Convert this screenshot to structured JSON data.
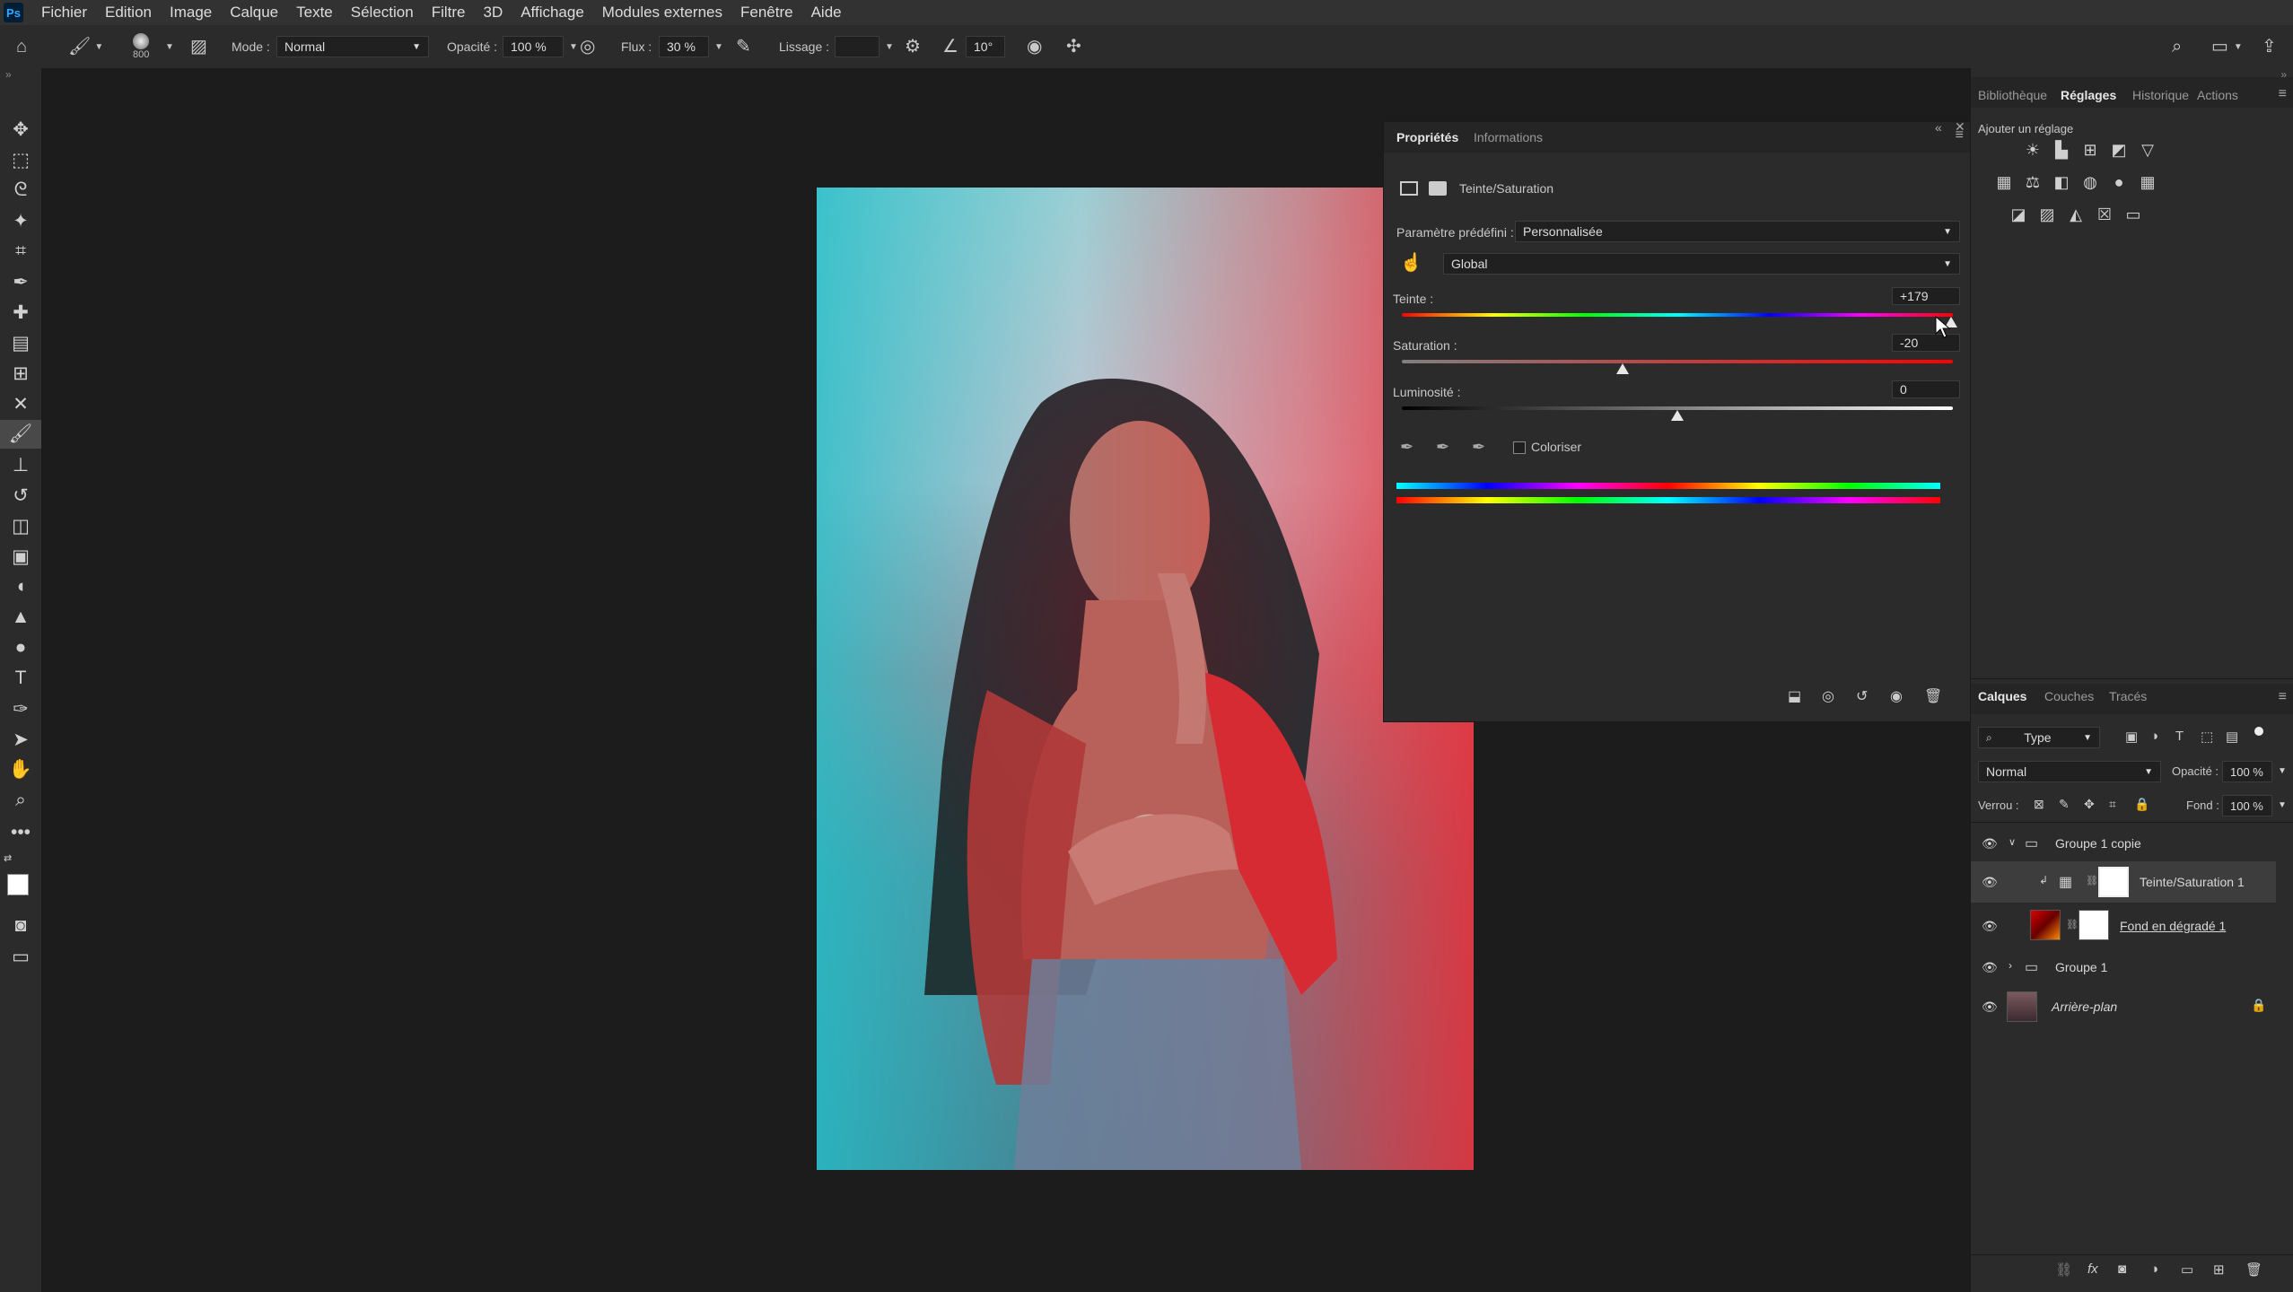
{
  "menu": {
    "app_logo": "Ps",
    "items": [
      "Fichier",
      "Edition",
      "Image",
      "Calque",
      "Texte",
      "Sélection",
      "Filtre",
      "3D",
      "Affichage",
      "Modules externes",
      "Fenêtre",
      "Aide"
    ]
  },
  "options": {
    "brush_size": "800",
    "mode_label": "Mode :",
    "mode_value": "Normal",
    "opacity_label": "Opacité :",
    "opacity_value": "100 %",
    "flow_label": "Flux :",
    "flow_value": "30 %",
    "smoothing_label": "Lissage :",
    "angle_value": "10°"
  },
  "properties": {
    "tabs": [
      "Propriétés",
      "Informations"
    ],
    "adjustment_title": "Teinte/Saturation",
    "preset_label": "Paramètre prédéfini :",
    "preset_value": "Personnalisée",
    "channel_value": "Global",
    "hue_label": "Teinte :",
    "hue_value": "+179",
    "hue_fraction": 0.997,
    "saturation_label": "Saturation :",
    "saturation_value": "-20",
    "saturation_fraction": 0.4,
    "lightness_label": "Luminosité :",
    "lightness_value": "0",
    "lightness_fraction": 0.5,
    "colorize_label": "Coloriser"
  },
  "adjustments_panel": {
    "tabs": [
      "Bibliothèque",
      "Réglages",
      "Historique",
      "Actions"
    ],
    "add_label": "Ajouter un réglage"
  },
  "layers_panel": {
    "tabs": [
      "Calques",
      "Couches",
      "Tracés"
    ],
    "filter_label": "Type",
    "blend_value": "Normal",
    "opacity_label": "Opacité :",
    "opacity_value": "100 %",
    "lock_label": "Verrou :",
    "fill_label": "Fond :",
    "fill_value": "100 %",
    "layers": [
      {
        "name": "Groupe 1 copie"
      },
      {
        "name": "Teinte/Saturation 1"
      },
      {
        "name": "Fond en dégradé 1"
      },
      {
        "name": "Groupe 1"
      },
      {
        "name": "Arrière-plan"
      }
    ]
  },
  "colors": {
    "accent": "#31a8ff",
    "panel_bg": "#2b2b2b",
    "canvas_bg": "#1c1c1c"
  }
}
